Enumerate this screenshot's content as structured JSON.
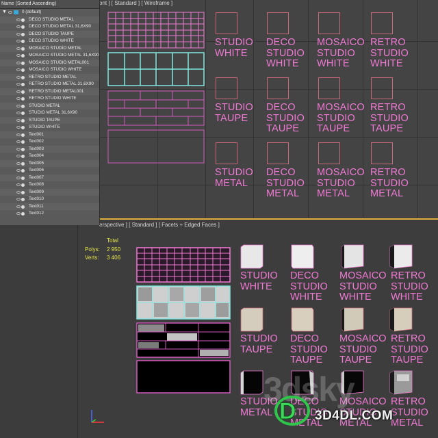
{
  "explorer": {
    "header": "Name (Sorted Ascending)",
    "layer": "0 (default)",
    "items": [
      "DECO STUDIO METAL",
      "DECO STUDIO METAL 31,6X90",
      "DECO STUDIO TAUPE",
      "DECO STUDIO WHITE",
      "MOSAICO STUDIO METAL",
      "MOSAICO STUDIO METAL 31,6X90",
      "MOSAICO STUDIO METAL001",
      "MOSAICO STUDIO WHITE",
      "RETRO STUDIO METAL",
      "RETRO STUDIO METAL 31,6X90",
      "RETRO STUDIO METAL001",
      "RETRO STUDIO WHITE",
      "STUDIO METAL",
      "STUDIO METAL 31,6X90",
      "STUDIO TAUPE",
      "STUDIO WHITE",
      "Text001",
      "Text002",
      "Text003",
      "Text004",
      "Text005",
      "Text006",
      "Text007",
      "Text008",
      "Text009",
      "Text010",
      "Text011",
      "Text012"
    ]
  },
  "viewport_top": {
    "label": "ont ] [ Standard ] [ Wireframe ]",
    "labels": {
      "r1c1": "STUDIO\nWHITE",
      "r1c2": "DECO\nSTUDIO\nWHITE",
      "r1c3": "MOSAICO\nSTUDIO\nWHITE",
      "r1c4": "RETRO\nSTUDIO\nWHITE",
      "r2c1": "STUDIO\nTAUPE",
      "r2c2": "DECO\nSTUDIO\nTAUPE",
      "r2c3": "MOSAICO\nSTUDIO\nTAUPE",
      "r2c4": "RETRO\nSTUDIO\nTAUPE",
      "r3c1": "STUDIO\nMETAL",
      "r3c2": "DECO\nSTUDIO\nMETAL",
      "r3c3": "MOSAICO\nSTUDIO\nMETAL",
      "r3c4": "RETRO\nSTUDIO\nMETAL"
    }
  },
  "viewport_bottom": {
    "label": "erspective ] [ Standard ] [ Facets + Edged Faces ]",
    "stats": {
      "total_label": "Total",
      "polys_label": "Polys:",
      "polys_value": "2 950",
      "verts_label": "Verts:",
      "verts_value": "3 406"
    },
    "labels": {
      "r1c1": "STUDIO\nWHITE",
      "r1c2": "DECO\nSTUDIO\nWHITE",
      "r1c3": "MOSAICO\nSTUDIO\nWHITE",
      "r1c4": "RETRO\nSTUDIO\nWHITE",
      "r2c1": "STUDIO\nTAUPE",
      "r2c2": "DECO\nSTUDIO\nTAUPE",
      "r2c3": "MOSAICO\nSTUDIO\nTAUPE",
      "r2c4": "RETRO\nSTUDIO\nTAUPE",
      "r3c1": "STUDIO\nMETAL",
      "r3c2": "DECO\nSTUDIO\nMETAL",
      "r3c3": "MOSAICO\nSTUDIO\nMETAL",
      "r3c4": "RETRO\nSTUDIO\nMETAL"
    }
  },
  "watermark": {
    "text": "3D4DL.COM",
    "bg_text": "3dsky"
  },
  "colors": {
    "magenta": "#f17ad4",
    "cyan": "#7fe8e0",
    "tile_outline": "#c86878",
    "active_border": "#e0b040",
    "stats_yellow": "#e6e64a"
  }
}
